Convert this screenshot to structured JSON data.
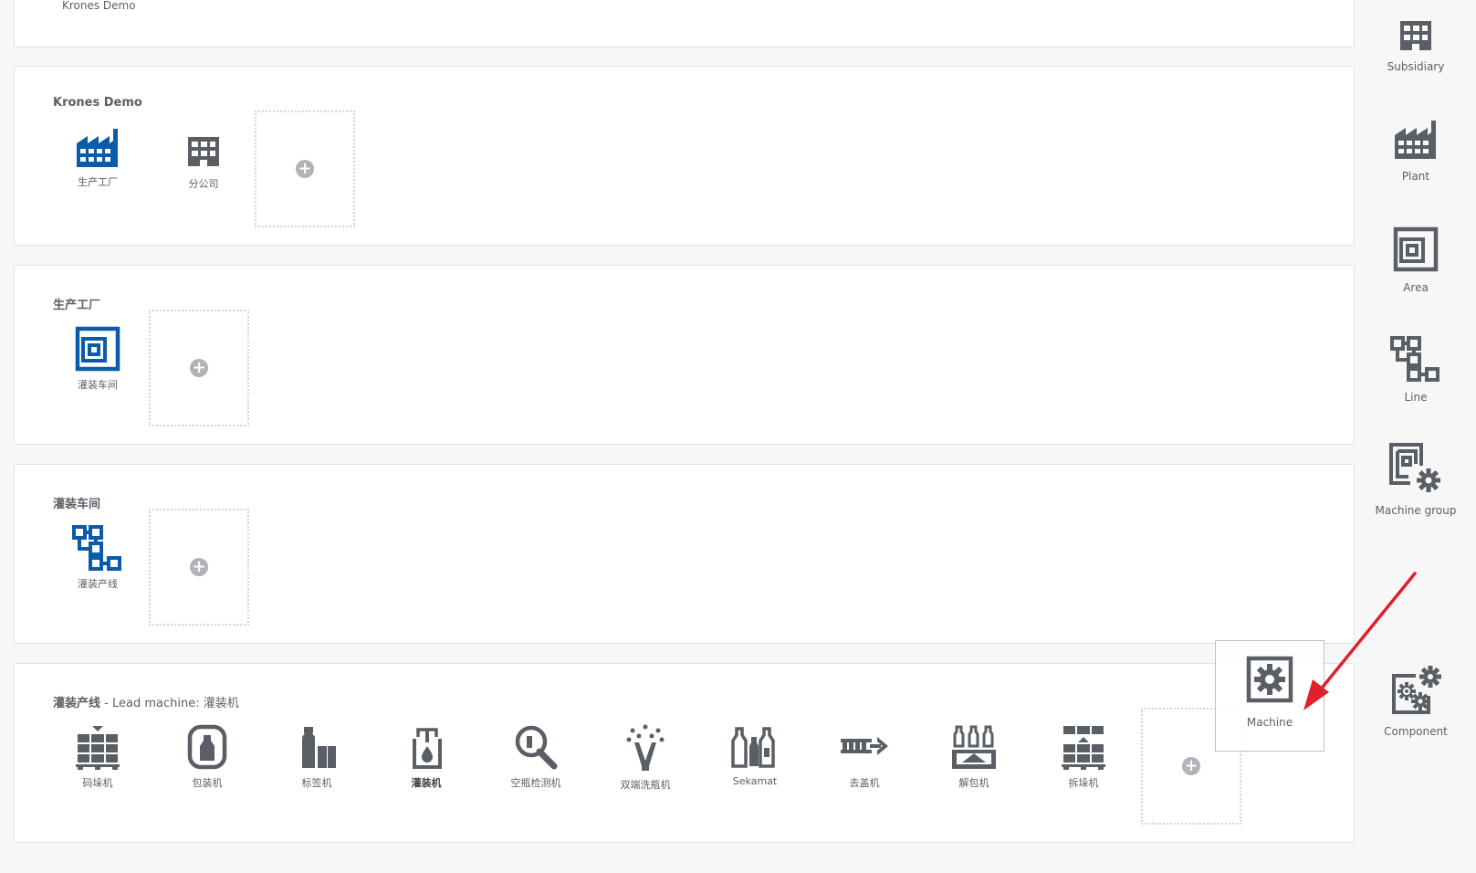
{
  "top_panel": {
    "title": "Krones Demo"
  },
  "panel1": {
    "title": "Krones Demo",
    "items": [
      {
        "label": "生产工厂",
        "icon": "plant-icon"
      },
      {
        "label": "分公司",
        "icon": "subsidiary-icon"
      }
    ]
  },
  "panel2": {
    "title": "生产工厂",
    "items": [
      {
        "label": "灌装车间",
        "icon": "area-icon"
      }
    ]
  },
  "panel3": {
    "title": "灌装车间",
    "items": [
      {
        "label": "灌装产线",
        "icon": "line-icon"
      }
    ]
  },
  "panel4": {
    "title": "灌装产线",
    "subtitle": " - Lead machine: 灌装机",
    "items": [
      {
        "label": "码垛机",
        "icon": "palletizer-icon"
      },
      {
        "label": "包装机",
        "icon": "packer-icon"
      },
      {
        "label": "标签机",
        "icon": "labeller-icon"
      },
      {
        "label": "灌装机",
        "icon": "filler-icon",
        "lead": true
      },
      {
        "label": "空瓶检测机",
        "icon": "inspector-icon"
      },
      {
        "label": "双端洗瓶机",
        "icon": "bottle-washer-icon"
      },
      {
        "label": "Sekamat",
        "icon": "sekamat-icon"
      },
      {
        "label": "去盖机",
        "icon": "decapper-icon"
      },
      {
        "label": "解包机",
        "icon": "unpacker-icon"
      },
      {
        "label": "拆垛机",
        "icon": "depalletizer-icon"
      }
    ]
  },
  "sidebar": {
    "items": [
      {
        "label": "Subsidiary",
        "icon": "subsidiary-icon"
      },
      {
        "label": "Plant",
        "icon": "plant-icon"
      },
      {
        "label": "Area",
        "icon": "area-icon"
      },
      {
        "label": "Line",
        "icon": "line-icon"
      },
      {
        "label": "Machine group",
        "icon": "machine-group-icon"
      },
      {
        "label": "Component",
        "icon": "component-icon"
      }
    ]
  },
  "drag_ghost": {
    "label": "Machine",
    "icon": "machine-icon"
  },
  "colors": {
    "accent": "#0a5cab",
    "icon_gray": "#5a5f66",
    "arrow": "#e0202a"
  }
}
